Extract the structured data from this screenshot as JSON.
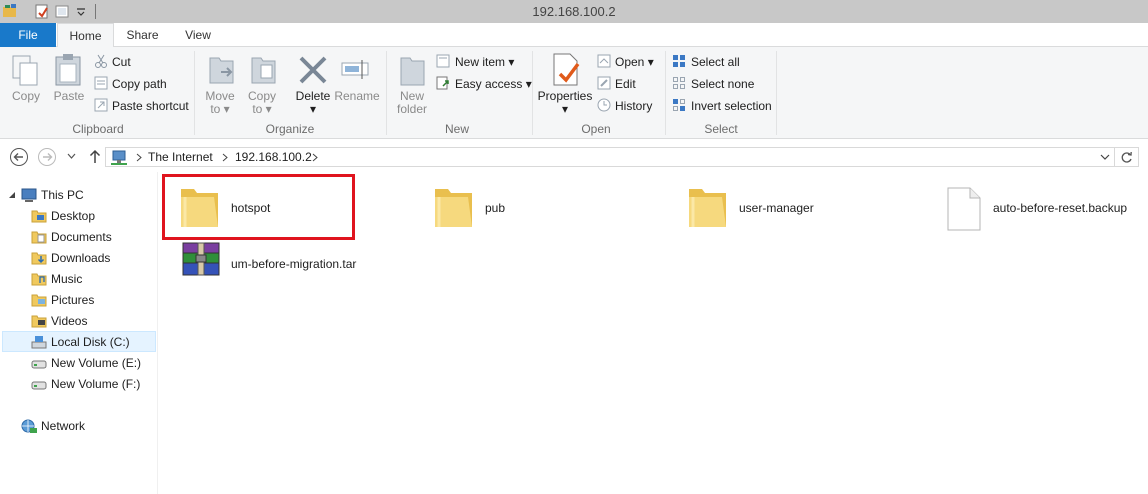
{
  "window": {
    "title": "192.168.100.2"
  },
  "tabs": [
    {
      "label": "File"
    },
    {
      "label": "Home"
    },
    {
      "label": "Share"
    },
    {
      "label": "View"
    }
  ],
  "ribbon": {
    "clipboard": {
      "copy": "Copy",
      "paste": "Paste",
      "cut": "Cut",
      "copy_path": "Copy path",
      "paste_shortcut": "Paste shortcut",
      "label": "Clipboard"
    },
    "organize": {
      "move_to_1": "Move",
      "move_to_2": "to",
      "copy_to_1": "Copy",
      "copy_to_2": "to",
      "delete": "Delete",
      "rename": "Rename",
      "label": "Organize"
    },
    "new": {
      "new_folder_1": "New",
      "new_folder_2": "folder",
      "new_item": "New item",
      "easy_access": "Easy access",
      "label": "New"
    },
    "open": {
      "properties": "Properties",
      "open": "Open",
      "edit": "Edit",
      "history": "History",
      "label": "Open"
    },
    "select": {
      "select_all": "Select all",
      "select_none": "Select none",
      "invert": "Invert selection",
      "label": "Select"
    }
  },
  "address": {
    "crumbs": [
      "The Internet",
      "192.168.100.2"
    ]
  },
  "nav": {
    "this_pc": "This PC",
    "items": [
      "Desktop",
      "Documents",
      "Downloads",
      "Music",
      "Pictures",
      "Videos",
      "Local Disk (C:)",
      "New Volume (E:)",
      "New Volume (F:)"
    ],
    "network": "Network"
  },
  "files": [
    {
      "name": "hotspot",
      "type": "folder"
    },
    {
      "name": "pub",
      "type": "folder"
    },
    {
      "name": "user-manager",
      "type": "folder"
    },
    {
      "name": "auto-before-reset.backup",
      "type": "file"
    },
    {
      "name": "um-before-migration.tar",
      "type": "archive"
    }
  ],
  "colors": {
    "file_tab": "#1979ca",
    "highlight_box": "#e0141e",
    "folder": "#f3d271"
  }
}
